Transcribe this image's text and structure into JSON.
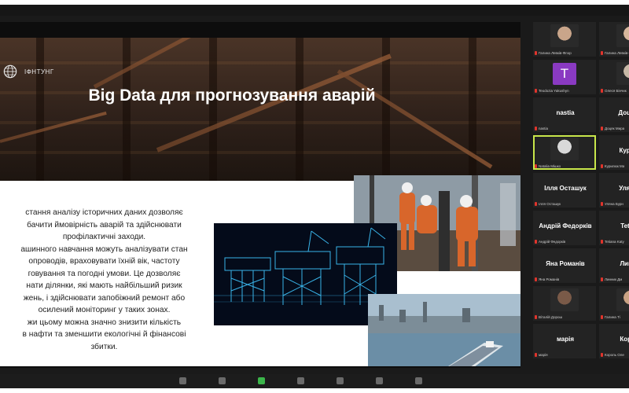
{
  "slide": {
    "logo_text": "ІФНТУНГ",
    "title": "Big Data для прогнозування аварій",
    "body_lines": [
      "стання аналізу історичних даних дозволяє",
      "бачити ймовірність аварій та здійснювати",
      "профілактичні заходи.",
      "ашинного навчання можуть аналізувати стан",
      "опроводів, враховувати їхній вік, частоту",
      "говування та погодні умови. Це дозволяє",
      "нати ділянки, які мають найбільший ризик",
      "жень, і здійснювати запобіжний ремонт або",
      "осилений моніторинг у таких зонах.",
      "жи цьому можна значно знизити кількість",
      "в нафти та зменшити екологічні й фінансові",
      "збитки."
    ],
    "images": [
      "oil-workers-photo",
      "offshore-platform-hologram",
      "port-tanker-photo"
    ]
  },
  "participants": [
    {
      "id": "p1",
      "display_name": "",
      "caption": "Галина Левків-Флор",
      "tile_type": "photo",
      "photo_color": "#c9a58a"
    },
    {
      "id": "p2",
      "display_name": "",
      "caption": "Галина Левків-Флор",
      "tile_type": "photo",
      "photo_color": "#d7b79c"
    },
    {
      "id": "p3",
      "display_name": "",
      "caption": "Teodozia Yakushyn",
      "tile_type": "letter",
      "letter": "T"
    },
    {
      "id": "p4",
      "display_name": "",
      "caption": "Олеся Бінчик",
      "tile_type": "photo",
      "photo_color": "#c7b8a6"
    },
    {
      "id": "p5",
      "display_name": "nastia",
      "caption": "nastia",
      "tile_type": "name"
    },
    {
      "id": "p6",
      "display_name": "Доцяк М",
      "caption": "Доцяк Мира",
      "tile_type": "name"
    },
    {
      "id": "p7",
      "display_name": "",
      "caption": "Natalia Мішко",
      "tile_type": "photo",
      "photo_color": "#d9d9d9",
      "active": true
    },
    {
      "id": "p8",
      "display_name": "Курилю",
      "caption": "Курилюк Ма",
      "tile_type": "name"
    },
    {
      "id": "p9",
      "display_name": "Ілля Осташук",
      "caption": "Ілля Осташук",
      "tile_type": "name"
    },
    {
      "id": "p10",
      "display_name": "Уляна Б",
      "caption": "Уляна Бурн",
      "tile_type": "name"
    },
    {
      "id": "p11",
      "display_name": "Андрій Федорків",
      "caption": "Андрій Федорків",
      "tile_type": "name"
    },
    {
      "id": "p12",
      "display_name": "Tetiana",
      "caption": "Tetiana Katy",
      "tile_type": "name"
    },
    {
      "id": "p13",
      "display_name": "Яна Романів",
      "caption": "Яна Романів",
      "tile_type": "name"
    },
    {
      "id": "p14",
      "display_name": "Линник",
      "caption": "Линник Дм",
      "tile_type": "name"
    },
    {
      "id": "p15",
      "display_name": "",
      "caption": "Віталій Дорош",
      "tile_type": "photo",
      "photo_color": "#7a5a48"
    },
    {
      "id": "p16",
      "display_name": "",
      "caption": "Галина Ті",
      "tile_type": "photo",
      "photo_color": "#caa384"
    },
    {
      "id": "p17",
      "display_name": "марія",
      "caption": "марія",
      "tile_type": "name"
    },
    {
      "id": "p18",
      "display_name": "Король",
      "caption": "Король Оле",
      "tile_type": "name"
    }
  ],
  "colors": {
    "active_speaker_border": "#c8e64a",
    "muted_mic": "#e0342c",
    "toolbar_green": "#3bb54a"
  }
}
